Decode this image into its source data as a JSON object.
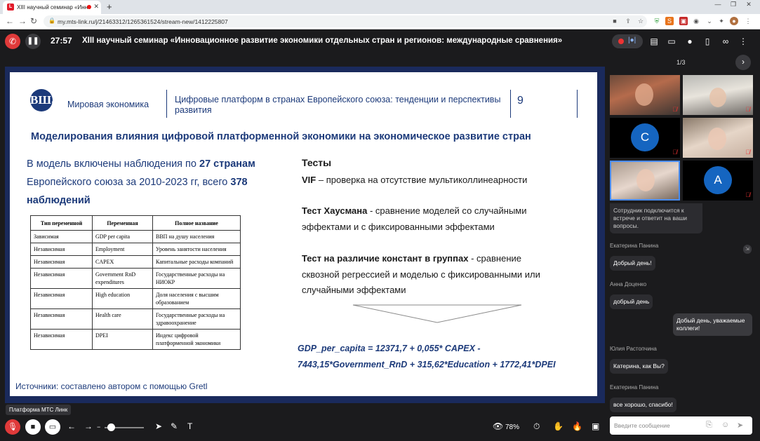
{
  "browser": {
    "tab_title": "XIII научный семинар «Инн",
    "url": "my.mts-link.ru/j/21463312/1265361524/stream-new/1412225807"
  },
  "webinar": {
    "timer": "27:57",
    "title": "XIII научный семинар «Инновационное развитие экономики отдельных стран и регионов: международные сравнения»"
  },
  "slide": {
    "logo": "ВШЭ",
    "course": "Мировая экономика",
    "subtitle": "Цифровые платформ в странах Европейского союза: тенденции и перспективы развития",
    "page_number": "9",
    "heading": "Моделирования влияния цифровой платформенной экономики на экономическое развитие стран",
    "intro_parts": [
      "В модель включены наблюдения по ",
      "27 странам",
      " Европейского союза за 2010-2023 гг, всего ",
      "378 наблюдений"
    ],
    "table": {
      "headers": [
        "Тип переменной",
        "Переменная",
        "Полное название"
      ],
      "rows": [
        [
          "Зависимая",
          "GDP per capita",
          "ВВП на душу населения"
        ],
        [
          "Независимая",
          "Employment",
          "Уровень занятости населения"
        ],
        [
          "Независимая",
          "CAPEX",
          "Капитальные расходы компаний"
        ],
        [
          "Независимая",
          "Government RnD expenditures",
          "Государственные расходы на НИОКР"
        ],
        [
          "Независимая",
          "High education",
          "Доля населения с высшим образованием"
        ],
        [
          "Независимая",
          "Health care",
          "Государственные расходы на здравоохранение"
        ],
        [
          "Независимая",
          "DPEI",
          "Индекс цифровой платформенной экономики"
        ]
      ]
    },
    "source": "Источники: составлено автором с помощью Gretl",
    "tests_title": "Тесты",
    "test_vif_bold": "VIF",
    "test_vif_text": " – проверка на отсутствие мультиколлинеарности",
    "test_hausman_bold": "Тест Хаусмана",
    "test_hausman_text": " - сравнение моделей со случайными эффектами и с фиксированными эффектами",
    "test_const_bold": "Тест на различие констант в группах",
    "test_const_text": " - сравнение сквозной регрессией и моделью с фиксированными или случайными эффектами",
    "formula_line1": "GDP_per_capita = 12371,7 + 0,055* CAPEX -",
    "formula_line2": "7443,15*Government_RnD + 315,62*Education + 1772,41*DPEI"
  },
  "panel": {
    "page_indicator": "1/3",
    "participants": [
      {
        "initial": ""
      },
      {
        "initial": ""
      },
      {
        "initial": "C"
      },
      {
        "initial": ""
      },
      {
        "initial": ""
      },
      {
        "initial": "A"
      }
    ],
    "chat": {
      "partial_message": "Сотрудник подключится к встрече и ответит на ваши вопросы.",
      "messages": [
        {
          "author": "Екатерина Панина",
          "text": "Добрый день!"
        },
        {
          "author": "Анна Доценко",
          "text": "добрый день"
        },
        {
          "author": "",
          "text": "Добый день, уважаемые коллеги!"
        },
        {
          "author": "Юлия Растопчина",
          "text": "Катерина, как Вы?"
        },
        {
          "author": "Екатерина Панина",
          "text": "все хорошо, спасибо!"
        }
      ],
      "input_placeholder": "Введите сообщение"
    }
  },
  "toolbar": {
    "brand_tooltip": "Платформа МТС Линк",
    "zoom": "78%"
  },
  "colors": {
    "accent": "#1c3a7a",
    "hangup": "#e03a3a",
    "avatar": "#1565c0"
  }
}
